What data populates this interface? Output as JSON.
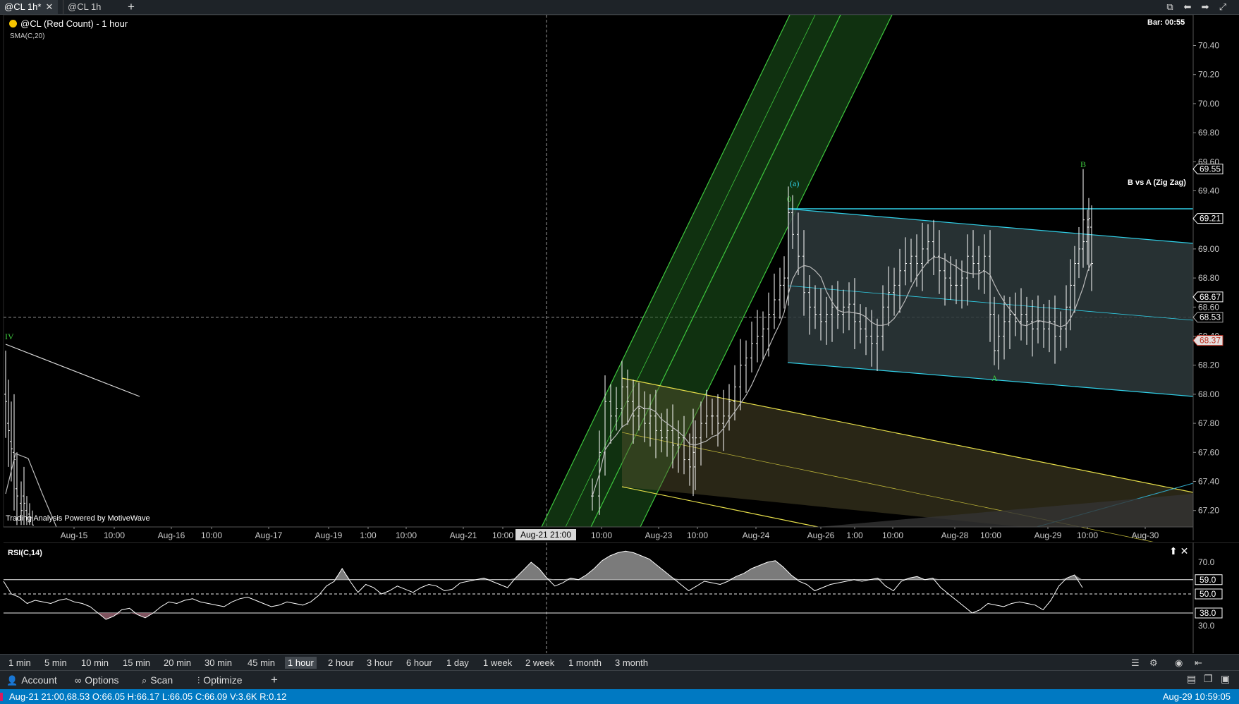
{
  "tabs": [
    {
      "label": "@CL 1h*",
      "active": true,
      "close": "✕"
    },
    {
      "label": "@CL 1h",
      "active": false
    }
  ],
  "add_tab": "+",
  "window_controls": [
    {
      "icon": "popout-icon",
      "glyph": "⧉"
    },
    {
      "icon": "back-arrow-icon",
      "glyph": "⬅"
    },
    {
      "icon": "forward-arrow-icon",
      "glyph": "➡"
    },
    {
      "icon": "maximize-icon",
      "glyph": "⤢"
    }
  ],
  "chart": {
    "title": "@CL (Red Count) - 1 hour",
    "indicator": "SMA(C,20)",
    "bar_timer": "Bar: 00:55",
    "study_label": "B vs A (Zig Zag)",
    "credit": "Trading Analysis Powered by MotiveWave",
    "wave_labels": [
      "IV",
      "(a)",
      "0",
      "A",
      "B"
    ],
    "colors": {
      "background": "#000000",
      "bars": "#ffffff",
      "green_channel": "#3ec93e",
      "cyan_channel": "#30d0e8",
      "yellow_channel": "#e8e04a",
      "sma": "#bbbbbb"
    }
  },
  "chart_data": [
    {
      "type": "candlestick",
      "title": "@CL (Red Count) - 1 hour",
      "ylim": [
        67.1,
        70.6
      ],
      "y_ticks": [
        "70.40",
        "70.20",
        "70.00",
        "69.80",
        "69.60",
        "69.40",
        "69.20",
        "69.00",
        "68.80",
        "68.60",
        "68.40",
        "68.20",
        "68.00",
        "67.80",
        "67.60",
        "67.40",
        "67.20"
      ],
      "x_ticks": [
        "Aug-15",
        "10:00",
        "Aug-16",
        "10:00",
        "Aug-17",
        "Aug-19",
        "1:00",
        "10:00",
        "Aug-21",
        "10:00",
        "10:00",
        "Aug-23",
        "10:00",
        "Aug-24",
        "Aug-26",
        "1:00",
        "10:00",
        "Aug-28",
        "10:00",
        "Aug-29",
        "10:00",
        "Aug-30"
      ],
      "crosshair_x_label": "Aug-21 21:00",
      "price_tags": [
        {
          "value": "69.55",
          "style": "outline"
        },
        {
          "value": "69.21",
          "style": "outline"
        },
        {
          "value": "68.67",
          "style": "outline"
        },
        {
          "value": "68.53",
          "style": "crosshair"
        },
        {
          "value": "68.37",
          "style": "red"
        }
      ],
      "series": [
        {
          "name": "SMA(C,20)"
        }
      ]
    },
    {
      "type": "line",
      "title": "RSI(C,14)",
      "ylim": [
        24,
        78
      ],
      "y_ticks": [
        "70.0",
        "30.0"
      ],
      "levels": [
        "59.0",
        "50.0",
        "38.0"
      ]
    }
  ],
  "timeframes": [
    "1 min",
    "5 min",
    "10 min",
    "15 min",
    "20 min",
    "30 min",
    "45 min",
    "1 hour",
    "2 hour",
    "3 hour",
    "6 hour",
    "1 day",
    "1 week",
    "2 week",
    "1 month",
    "3 month"
  ],
  "selected_timeframe": "1 hour",
  "toolbar": [
    {
      "label": "Account",
      "icon": "account-icon",
      "glyph": "👤"
    },
    {
      "label": "Options",
      "icon": "link-icon",
      "glyph": "∞"
    },
    {
      "label": "Scan",
      "icon": "scan-icon",
      "glyph": "⌕"
    },
    {
      "label": "Optimize",
      "icon": "sliders-icon",
      "glyph": "⫶"
    }
  ],
  "toolbar_add": "+",
  "status": {
    "left": "Aug-21 21:00,68.53 O:66.05 H:66.17 L:66.05 C:66.09 V:3.6K R:0.12",
    "right": "Aug-29 10:59:05"
  }
}
